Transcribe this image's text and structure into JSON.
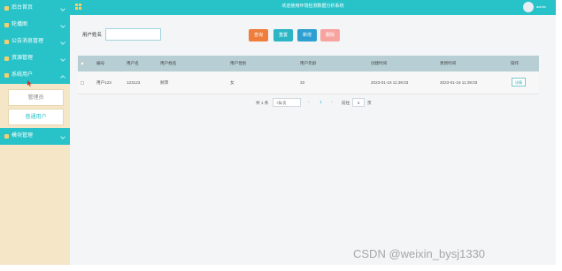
{
  "app": {
    "title": "欢迎使用环境检测数据分析系统",
    "user": "admin"
  },
  "colors": {
    "teal": "#27c3c9",
    "sidebar_bg": "#f5e6c8",
    "search_btn": "#ef7d3c",
    "reset_btn": "#2cb6c5",
    "add_btn": "#2e9fd1",
    "delete_btn": "#f7a4a0"
  },
  "sidebar": {
    "items": [
      {
        "label": "后台首页",
        "icon": "home-icon"
      },
      {
        "label": "轮播图",
        "icon": "image-icon"
      },
      {
        "label": "公告消息管理",
        "icon": "notice-icon"
      },
      {
        "label": "资源管理",
        "icon": "folder-icon"
      },
      {
        "label": "系统用户",
        "icon": "user-icon"
      },
      {
        "label": "模块管理",
        "icon": "module-icon"
      }
    ],
    "sub_items": [
      "管理员",
      "普通用户"
    ]
  },
  "search": {
    "label": "用户姓名",
    "value": ""
  },
  "buttons": {
    "search": "查询",
    "reset": "重置",
    "add": "新增",
    "delete": "删除"
  },
  "table": {
    "headers": [
      "编号",
      "用户名",
      "用户姓名",
      "用户性别",
      "用户年龄",
      "创建时间",
      "更新时间",
      "操作"
    ],
    "rows": [
      {
        "id": "用户123",
        "username": "123123",
        "name": "顾萍",
        "gender": "女",
        "age": "33",
        "created": "2023-01-16 11:39:03",
        "updated": "2023-01-16 11:39:03",
        "action": "详情"
      }
    ]
  },
  "pagination": {
    "total": "共 1 条",
    "page_size": "7条/页",
    "prev": "‹",
    "current": "1",
    "next": "›",
    "goto_label": "前往",
    "goto_value": "1",
    "page_unit": "页"
  },
  "watermark": "CSDN @weixin_bysj1330"
}
